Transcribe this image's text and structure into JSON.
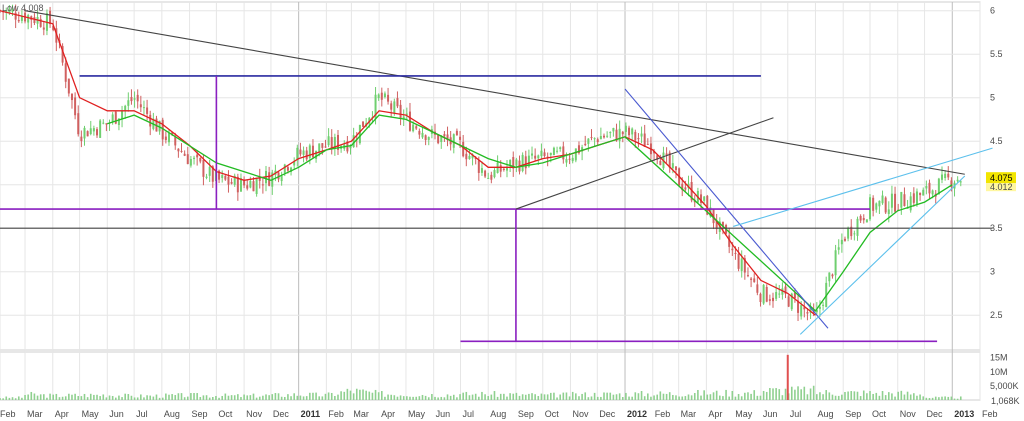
{
  "header": {
    "low_label": "Low 4.008"
  },
  "colors": {
    "up": "#6fcf6f",
    "down": "#d06060",
    "ma_fast": "#e02020",
    "ma_slow": "#22bb22",
    "grid": "#e6e6e6",
    "resistance_navy": "#2a2aa0",
    "purple": "#8a1fc0",
    "trend_dark": "#444444",
    "trend_blue": "#4a5ad0",
    "trend_cyan": "#5cc0ec",
    "volume": "#8fd08f",
    "volume_spike": "#e05050",
    "badge_bg": "#f2e500"
  },
  "chart_data": {
    "type": "candlestick",
    "title": "",
    "y_axis": {
      "min": 2.1,
      "max": 6.1,
      "ticks": [
        "6",
        "5.5",
        "5",
        "4.5",
        "4",
        "3.5",
        "3",
        "2.5"
      ],
      "position": "right"
    },
    "volume_axis": {
      "ticks": [
        "15M",
        "10M",
        "5,000K"
      ],
      "last_value_label": "1,068K"
    },
    "x_axis": {
      "ticks": [
        "Feb",
        "Mar",
        "Apr",
        "May",
        "Jun",
        "Jul",
        "Aug",
        "Sep",
        "Oct",
        "Nov",
        "Dec",
        "2011",
        "Feb",
        "Mar",
        "Apr",
        "May",
        "Jun",
        "Jul",
        "Aug",
        "Sep",
        "Oct",
        "Nov",
        "Dec",
        "2012",
        "Feb",
        "Mar",
        "Apr",
        "May",
        "Jun",
        "Jul",
        "Aug",
        "Sep",
        "Oct",
        "Nov",
        "Dec",
        "2013",
        "Feb"
      ],
      "year_labels": [
        "2011",
        "2012",
        "2013"
      ],
      "start": "2010-02-01",
      "end": "2013-02-01"
    },
    "last_price_label": "4.075",
    "last_price_value": 4.075,
    "secondary_price_label": "4.012",
    "series": [
      {
        "kind": "close",
        "points": [
          [
            "2010-02-01",
            6.0
          ],
          [
            "2010-03-01",
            5.95
          ],
          [
            "2010-04-01",
            5.85
          ],
          [
            "2010-05-01",
            4.6
          ],
          [
            "2010-06-01",
            4.7
          ],
          [
            "2010-07-01",
            5.0
          ],
          [
            "2010-08-01",
            4.6
          ],
          [
            "2010-09-01",
            4.3
          ],
          [
            "2010-10-01",
            4.05
          ],
          [
            "2010-11-01",
            4.0
          ],
          [
            "2010-12-01",
            4.1
          ],
          [
            "2011-01-01",
            4.35
          ],
          [
            "2011-02-01",
            4.45
          ],
          [
            "2011-03-01",
            4.5
          ],
          [
            "2011-04-01",
            5.0
          ],
          [
            "2011-05-01",
            4.75
          ],
          [
            "2011-06-01",
            4.55
          ],
          [
            "2011-07-01",
            4.45
          ],
          [
            "2011-08-01",
            4.1
          ],
          [
            "2011-09-01",
            4.25
          ],
          [
            "2011-10-01",
            4.3
          ],
          [
            "2011-11-01",
            4.35
          ],
          [
            "2011-12-01",
            4.55
          ],
          [
            "2012-01-01",
            4.6
          ],
          [
            "2012-02-01",
            4.45
          ],
          [
            "2012-03-01",
            4.05
          ],
          [
            "2012-04-01",
            3.75
          ],
          [
            "2012-05-01",
            3.2
          ],
          [
            "2012-06-01",
            2.75
          ],
          [
            "2012-07-01",
            2.7
          ],
          [
            "2012-08-01",
            2.45
          ],
          [
            "2012-09-01",
            3.4
          ],
          [
            "2012-10-01",
            3.75
          ],
          [
            "2012-11-01",
            3.8
          ],
          [
            "2012-12-01",
            3.9
          ],
          [
            "2013-01-01",
            4.075
          ]
        ]
      }
    ],
    "moving_averages": [
      {
        "color": "red",
        "points": [
          [
            "2010-02-01",
            6.0
          ],
          [
            "2010-04-01",
            5.85
          ],
          [
            "2010-05-01",
            5.0
          ],
          [
            "2010-06-01",
            4.85
          ],
          [
            "2010-07-01",
            4.85
          ],
          [
            "2010-08-01",
            4.7
          ],
          [
            "2010-09-01",
            4.45
          ],
          [
            "2010-10-01",
            4.15
          ],
          [
            "2010-11-01",
            4.05
          ],
          [
            "2010-12-01",
            4.1
          ],
          [
            "2011-01-01",
            4.3
          ],
          [
            "2011-02-01",
            4.4
          ],
          [
            "2011-03-01",
            4.5
          ],
          [
            "2011-04-01",
            4.85
          ],
          [
            "2011-05-01",
            4.8
          ],
          [
            "2011-06-01",
            4.6
          ],
          [
            "2011-07-01",
            4.45
          ],
          [
            "2011-08-01",
            4.2
          ],
          [
            "2011-09-01",
            4.2
          ],
          [
            "2011-10-01",
            4.3
          ],
          [
            "2011-11-01",
            4.35
          ],
          [
            "2011-12-01",
            4.45
          ],
          [
            "2012-01-01",
            4.55
          ],
          [
            "2012-02-01",
            4.4
          ],
          [
            "2012-03-01",
            4.1
          ],
          [
            "2012-04-01",
            3.75
          ],
          [
            "2012-05-01",
            3.3
          ],
          [
            "2012-06-01",
            2.9
          ],
          [
            "2012-07-01",
            2.75
          ],
          [
            "2012-08-01",
            2.5
          ]
        ]
      },
      {
        "color": "green",
        "points": [
          [
            "2010-06-01",
            4.7
          ],
          [
            "2010-07-01",
            4.8
          ],
          [
            "2010-08-01",
            4.65
          ],
          [
            "2010-10-01",
            4.25
          ],
          [
            "2010-12-01",
            4.05
          ],
          [
            "2011-01-01",
            4.2
          ],
          [
            "2011-02-01",
            4.4
          ],
          [
            "2011-03-01",
            4.45
          ],
          [
            "2011-04-01",
            4.8
          ],
          [
            "2011-05-01",
            4.75
          ],
          [
            "2011-06-01",
            4.6
          ],
          [
            "2011-08-01",
            4.3
          ],
          [
            "2011-09-01",
            4.2
          ],
          [
            "2011-10-01",
            4.25
          ],
          [
            "2011-12-01",
            4.45
          ],
          [
            "2012-01-01",
            4.55
          ],
          [
            "2012-08-01",
            2.55
          ],
          [
            "2012-09-01",
            3.0
          ],
          [
            "2012-10-01",
            3.45
          ],
          [
            "2012-11-01",
            3.7
          ],
          [
            "2012-12-01",
            3.8
          ],
          [
            "2013-01-01",
            4.0
          ]
        ]
      }
    ],
    "annotation_lines": [
      {
        "name": "long-downtrend",
        "color": "dark",
        "from": [
          "2010-03-01",
          6.0
        ],
        "to": [
          "2013-01-15",
          4.12
        ]
      },
      {
        "name": "resistance-5-25",
        "color": "navy",
        "from": [
          "2010-05-01",
          5.25
        ],
        "to": [
          "2012-06-01",
          5.25
        ]
      },
      {
        "name": "support-3-72",
        "color": "purple",
        "from": [
          "2010-02-01",
          3.72
        ],
        "to": [
          "2012-10-01",
          3.72
        ]
      },
      {
        "name": "level-3-5",
        "color": "dark",
        "from": [
          "2010-02-01",
          3.5
        ],
        "to": [
          "2013-02-15",
          3.5
        ]
      },
      {
        "name": "lower-purple",
        "color": "purple",
        "from": [
          "2011-07-01",
          2.2
        ],
        "to": [
          "2012-12-15",
          2.2
        ]
      },
      {
        "name": "measure-top",
        "color": "purple",
        "from": [
          "2010-10-01",
          5.25
        ],
        "to": [
          "2010-10-01",
          3.72
        ]
      },
      {
        "name": "measure-bottom",
        "color": "purple",
        "from": [
          "2011-09-01",
          3.72
        ],
        "to": [
          "2011-09-01",
          2.2
        ]
      },
      {
        "name": "rising-trend-2011",
        "color": "dark",
        "from": [
          "2011-09-01",
          3.72
        ],
        "to": [
          "2012-06-15",
          4.77
        ]
      },
      {
        "name": "falling-trend-2012",
        "color": "blue",
        "from": [
          "2012-01-01",
          5.1
        ],
        "to": [
          "2012-08-15",
          2.35
        ]
      },
      {
        "name": "channel-upper",
        "color": "cyan",
        "from": [
          "2012-05-01",
          3.52
        ],
        "to": [
          "2013-02-15",
          4.42
        ]
      },
      {
        "name": "channel-lower",
        "color": "cyan",
        "from": [
          "2012-07-15",
          2.28
        ],
        "to": [
          "2013-01-15",
          4.1
        ]
      }
    ],
    "volume_bars": {
      "baseline": 1.0,
      "points": [
        [
          "2010-03-01",
          2.4
        ],
        [
          "2010-04-01",
          1.8
        ],
        [
          "2010-06-01",
          2.2
        ],
        [
          "2010-07-01",
          1.6
        ],
        [
          "2010-09-01",
          2.0
        ],
        [
          "2010-11-01",
          1.7
        ],
        [
          "2011-01-01",
          2.3
        ],
        [
          "2011-02-01",
          2.0
        ],
        [
          "2011-03-01",
          4.0
        ],
        [
          "2011-04-01",
          2.6
        ],
        [
          "2011-06-01",
          2.2
        ],
        [
          "2011-08-01",
          2.5
        ],
        [
          "2011-10-01",
          2.0
        ],
        [
          "2011-12-01",
          2.4
        ],
        [
          "2012-02-01",
          2.6
        ],
        [
          "2012-04-01",
          2.9
        ],
        [
          "2012-06-01",
          3.0
        ],
        [
          "2012-07-01",
          16.0
        ],
        [
          "2012-08-01",
          3.2
        ],
        [
          "2012-10-01",
          3.0
        ],
        [
          "2012-12-01",
          2.6
        ]
      ],
      "spike_at": "2012-07-01"
    }
  }
}
